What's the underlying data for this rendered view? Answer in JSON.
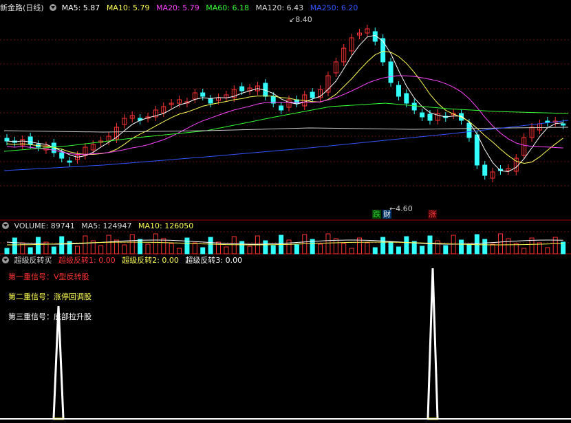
{
  "main_header": {
    "title": "新金路(日线)",
    "indicators": [
      {
        "label": "MA5: 5.87",
        "color": "#ffffff"
      },
      {
        "label": "MA10: 5.79",
        "color": "#ffff55"
      },
      {
        "label": "MA20: 5.79",
        "color": "#ff44ff"
      },
      {
        "label": "MA60: 6.18",
        "color": "#33ff33"
      },
      {
        "label": "MA120: 6.43",
        "color": "#dddddd"
      },
      {
        "label": "MA250: 6.20",
        "color": "#3355ff"
      }
    ]
  },
  "price_chart": {
    "high_label": "8.40",
    "low_label": "4.60",
    "badges": [
      {
        "text": "跌",
        "color": "#33cc33",
        "bg": "#004400"
      },
      {
        "text": "财",
        "color": "#ffffff",
        "bg": "#003366"
      },
      {
        "text": "涨",
        "color": "#ff4444",
        "bg": "#440000"
      }
    ]
  },
  "volume_header": {
    "items": [
      {
        "label": "VOLUME: 89741",
        "color": "#dddddd"
      },
      {
        "label": "MA5: 124947",
        "color": "#dddddd"
      },
      {
        "label": "MA10: 126050",
        "color": "#ffff55"
      }
    ]
  },
  "signal_header": {
    "title": "超级反转买",
    "items": [
      {
        "label": "超级反转1: 0.00",
        "color": "#ff3333"
      },
      {
        "label": "超级反转2: 0.00",
        "color": "#ffff55"
      },
      {
        "label": "超级反转3: 0.00",
        "color": "#ffffff"
      }
    ]
  },
  "signals": [
    {
      "prefix": "第一重信号：",
      "text": "V型反转股",
      "color": "#ff3333"
    },
    {
      "prefix": "第二重信号：",
      "text": "涨停回调股",
      "color": "#ffff55"
    },
    {
      "prefix": "第三重信号：",
      "text": "底部拉升股",
      "color": "#ffffff"
    }
  ]
}
